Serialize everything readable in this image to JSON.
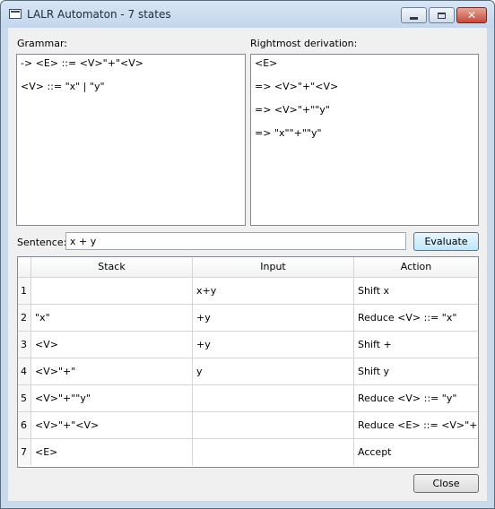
{
  "window": {
    "title": "LALR Automaton - 7 states",
    "controls": {
      "minimize_icon": "minimize-icon",
      "maximize_icon": "maximize-icon",
      "close_icon": "close-icon",
      "close_glyph": "✕"
    }
  },
  "grammar": {
    "label": "Grammar:",
    "lines": [
      "-> <E> ::= <V>\"+\"<V>",
      "<V> ::= \"x\" | \"y\""
    ]
  },
  "derivation": {
    "label": "Rightmost derivation:",
    "lines": [
      "<E>",
      "=> <V>\"+\"<V>",
      "=> <V>\"+\"\"y\"",
      "=> \"x\"\"+\"\"y\""
    ]
  },
  "sentence": {
    "label": "Sentence:",
    "value": "x + y"
  },
  "buttons": {
    "evaluate": "Evaluate",
    "close": "Close"
  },
  "table": {
    "headers": {
      "stack": "Stack",
      "input": "Input",
      "action": "Action"
    },
    "rows": [
      {
        "idx": "1",
        "stack": "",
        "input": "x+y",
        "action": "Shift x"
      },
      {
        "idx": "2",
        "stack": "\"x\"",
        "input": "+y",
        "action": "Reduce <V> ::= \"x\""
      },
      {
        "idx": "3",
        "stack": "<V>",
        "input": "+y",
        "action": "Shift +"
      },
      {
        "idx": "4",
        "stack": "<V>\"+\"",
        "input": "y",
        "action": "Shift y"
      },
      {
        "idx": "5",
        "stack": "<V>\"+\"\"y\"",
        "input": "",
        "action": "Reduce <V> ::= \"y\""
      },
      {
        "idx": "6",
        "stack": "<V>\"+\"<V>",
        "input": "",
        "action": "Reduce <E> ::= <V>\"+..."
      },
      {
        "idx": "7",
        "stack": "<E>",
        "input": "",
        "action": "Accept"
      }
    ]
  }
}
